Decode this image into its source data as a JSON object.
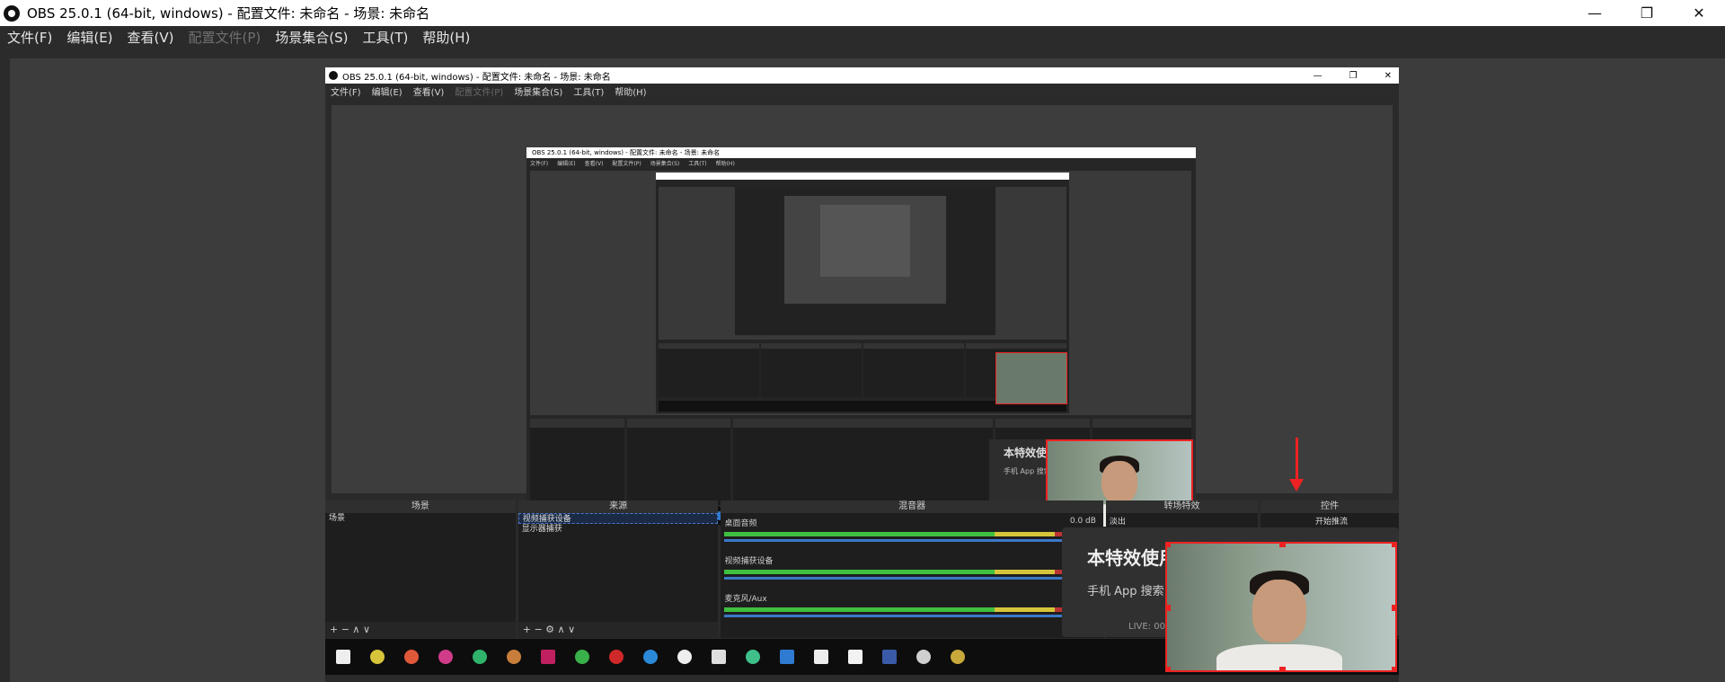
{
  "window": {
    "title": "OBS 25.0.1 (64-bit, windows) - 配置文件: 未命名 - 场景: 未命名",
    "minimize": "—",
    "maximize": "❐",
    "close": "✕"
  },
  "menu": {
    "file": "文件(F)",
    "edit": "编辑(E)",
    "view": "查看(V)",
    "profile": "配置文件(P)",
    "scene_collection": "场景集合(S)",
    "tools": "工具(T)",
    "help": "帮助(H)"
  },
  "nested": {
    "title": "OBS 25.0.1 (64-bit, windows) - 配置文件: 未命名 - 场景: 未命名",
    "l2_title": "OBS 25.0.1 (64-bit, windows) - 配置文件: 未命名 - 场景: 未命名",
    "docks": {
      "scenes": {
        "header": "场景",
        "item": "场景",
        "footer": "+ − ∧ ∨"
      },
      "sources": {
        "header": "来源",
        "items": [
          "视频捕获设备",
          "显示器捕获"
        ],
        "footer": "+ − ⚙ ∧ ∨"
      },
      "mixer": {
        "header": "混音器",
        "channels": [
          {
            "name": "桌面音频",
            "db": "0.0 dB"
          },
          {
            "name": "视频捕获设备"
          },
          {
            "name": "麦克风/Aux"
          }
        ]
      },
      "transitions": {
        "header": "转场特效",
        "value": "淡出"
      },
      "controls": {
        "header": "控件",
        "start_stream": "开始推流"
      }
    },
    "overlay": {
      "headline": "本特效使用",
      "subline": "手机 App 搜索：",
      "live": "LIVE: 00"
    }
  },
  "colors": {
    "accent_red": "#e22222",
    "selection_blue": "#4a78c8",
    "meter_green": "#3fbf3f"
  }
}
